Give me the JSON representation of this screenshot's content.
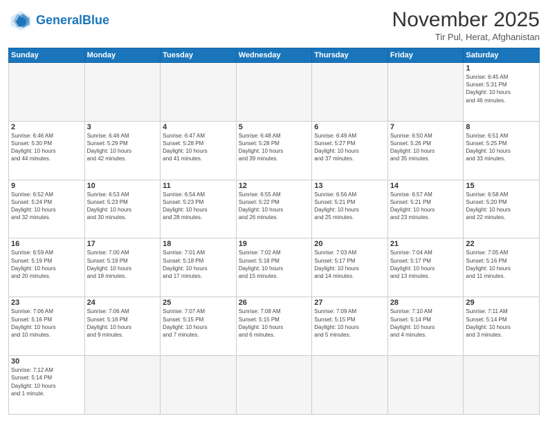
{
  "header": {
    "logo_general": "General",
    "logo_blue": "Blue",
    "month_year": "November 2025",
    "location": "Tir Pul, Herat, Afghanistan"
  },
  "weekdays": [
    "Sunday",
    "Monday",
    "Tuesday",
    "Wednesday",
    "Thursday",
    "Friday",
    "Saturday"
  ],
  "weeks": [
    [
      {
        "day": "",
        "info": ""
      },
      {
        "day": "",
        "info": ""
      },
      {
        "day": "",
        "info": ""
      },
      {
        "day": "",
        "info": ""
      },
      {
        "day": "",
        "info": ""
      },
      {
        "day": "",
        "info": ""
      },
      {
        "day": "1",
        "info": "Sunrise: 6:45 AM\nSunset: 5:31 PM\nDaylight: 10 hours\nand 46 minutes."
      }
    ],
    [
      {
        "day": "2",
        "info": "Sunrise: 6:46 AM\nSunset: 5:30 PM\nDaylight: 10 hours\nand 44 minutes."
      },
      {
        "day": "3",
        "info": "Sunrise: 6:46 AM\nSunset: 5:29 PM\nDaylight: 10 hours\nand 42 minutes."
      },
      {
        "day": "4",
        "info": "Sunrise: 6:47 AM\nSunset: 5:28 PM\nDaylight: 10 hours\nand 41 minutes."
      },
      {
        "day": "5",
        "info": "Sunrise: 6:48 AM\nSunset: 5:28 PM\nDaylight: 10 hours\nand 39 minutes."
      },
      {
        "day": "6",
        "info": "Sunrise: 6:49 AM\nSunset: 5:27 PM\nDaylight: 10 hours\nand 37 minutes."
      },
      {
        "day": "7",
        "info": "Sunrise: 6:50 AM\nSunset: 5:26 PM\nDaylight: 10 hours\nand 35 minutes."
      },
      {
        "day": "8",
        "info": "Sunrise: 6:51 AM\nSunset: 5:25 PM\nDaylight: 10 hours\nand 33 minutes."
      }
    ],
    [
      {
        "day": "9",
        "info": "Sunrise: 6:52 AM\nSunset: 5:24 PM\nDaylight: 10 hours\nand 32 minutes."
      },
      {
        "day": "10",
        "info": "Sunrise: 6:53 AM\nSunset: 5:23 PM\nDaylight: 10 hours\nand 30 minutes."
      },
      {
        "day": "11",
        "info": "Sunrise: 6:54 AM\nSunset: 5:23 PM\nDaylight: 10 hours\nand 28 minutes."
      },
      {
        "day": "12",
        "info": "Sunrise: 6:55 AM\nSunset: 5:22 PM\nDaylight: 10 hours\nand 26 minutes."
      },
      {
        "day": "13",
        "info": "Sunrise: 6:56 AM\nSunset: 5:21 PM\nDaylight: 10 hours\nand 25 minutes."
      },
      {
        "day": "14",
        "info": "Sunrise: 6:57 AM\nSunset: 5:21 PM\nDaylight: 10 hours\nand 23 minutes."
      },
      {
        "day": "15",
        "info": "Sunrise: 6:58 AM\nSunset: 5:20 PM\nDaylight: 10 hours\nand 22 minutes."
      }
    ],
    [
      {
        "day": "16",
        "info": "Sunrise: 6:59 AM\nSunset: 5:19 PM\nDaylight: 10 hours\nand 20 minutes."
      },
      {
        "day": "17",
        "info": "Sunrise: 7:00 AM\nSunset: 5:19 PM\nDaylight: 10 hours\nand 18 minutes."
      },
      {
        "day": "18",
        "info": "Sunrise: 7:01 AM\nSunset: 5:18 PM\nDaylight: 10 hours\nand 17 minutes."
      },
      {
        "day": "19",
        "info": "Sunrise: 7:02 AM\nSunset: 5:18 PM\nDaylight: 10 hours\nand 15 minutes."
      },
      {
        "day": "20",
        "info": "Sunrise: 7:03 AM\nSunset: 5:17 PM\nDaylight: 10 hours\nand 14 minutes."
      },
      {
        "day": "21",
        "info": "Sunrise: 7:04 AM\nSunset: 5:17 PM\nDaylight: 10 hours\nand 13 minutes."
      },
      {
        "day": "22",
        "info": "Sunrise: 7:05 AM\nSunset: 5:16 PM\nDaylight: 10 hours\nand 11 minutes."
      }
    ],
    [
      {
        "day": "23",
        "info": "Sunrise: 7:06 AM\nSunset: 5:16 PM\nDaylight: 10 hours\nand 10 minutes."
      },
      {
        "day": "24",
        "info": "Sunrise: 7:06 AM\nSunset: 5:16 PM\nDaylight: 10 hours\nand 9 minutes."
      },
      {
        "day": "25",
        "info": "Sunrise: 7:07 AM\nSunset: 5:15 PM\nDaylight: 10 hours\nand 7 minutes."
      },
      {
        "day": "26",
        "info": "Sunrise: 7:08 AM\nSunset: 5:15 PM\nDaylight: 10 hours\nand 6 minutes."
      },
      {
        "day": "27",
        "info": "Sunrise: 7:09 AM\nSunset: 5:15 PM\nDaylight: 10 hours\nand 5 minutes."
      },
      {
        "day": "28",
        "info": "Sunrise: 7:10 AM\nSunset: 5:14 PM\nDaylight: 10 hours\nand 4 minutes."
      },
      {
        "day": "29",
        "info": "Sunrise: 7:11 AM\nSunset: 5:14 PM\nDaylight: 10 hours\nand 3 minutes."
      }
    ],
    [
      {
        "day": "30",
        "info": "Sunrise: 7:12 AM\nSunset: 5:14 PM\nDaylight: 10 hours\nand 1 minute."
      },
      {
        "day": "",
        "info": ""
      },
      {
        "day": "",
        "info": ""
      },
      {
        "day": "",
        "info": ""
      },
      {
        "day": "",
        "info": ""
      },
      {
        "day": "",
        "info": ""
      },
      {
        "day": "",
        "info": ""
      }
    ]
  ]
}
